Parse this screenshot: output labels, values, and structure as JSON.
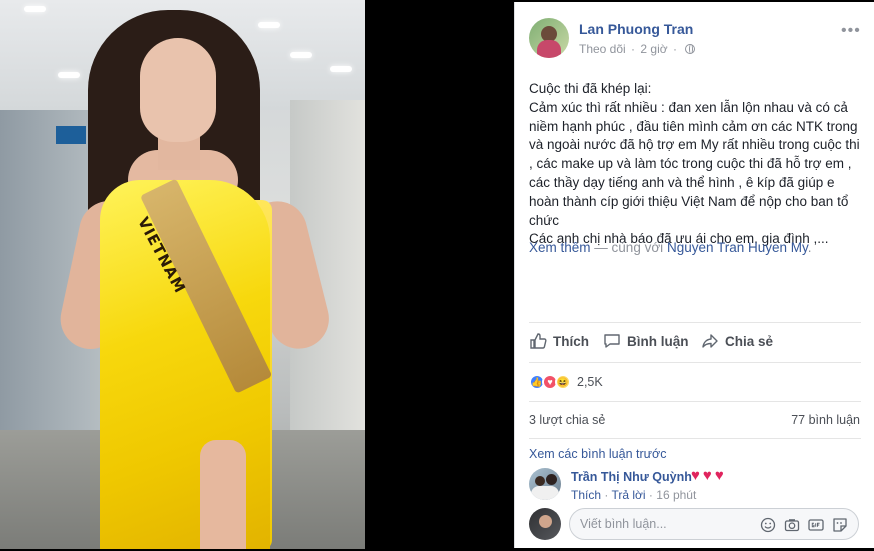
{
  "post": {
    "author": "Lan Phuong Tran",
    "follow_label": "Theo dõi",
    "time": "2 giờ",
    "body_lines": [
      "Cuộc thi đã khép lại:",
      "Cảm xúc thì rất nhiều : đan xen lẫn lộn nhau và có cả niềm hạnh phúc , đầu tiên mình cảm ơn các NTK trong và ngoài nước đã hộ trợ em My rất nhiều trong cuộc thi , các make up và làm tóc trong cuộc thi đã hỗ trợ em , các thầy dạy tiếng anh và thể hình , ê kíp đã giúp e hoàn thành cíp giới thiệu Việt Nam để nộp cho ban tổ chức",
      "Các anh chị nhà báo đã ưu ái cho em, gia đình ,..."
    ],
    "see_more": "Xem thêm",
    "with_text": "— cùng với",
    "tagged": "Nguyen Tran Huyen My",
    "tagged_suffix": "."
  },
  "photo": {
    "sash_text": "VIETNAM"
  },
  "actions": {
    "like": "Thích",
    "comment": "Bình luận",
    "share": "Chia sẻ"
  },
  "reactions": {
    "count": "2,5K"
  },
  "stats": {
    "shares": "3 lượt chia sẻ",
    "comments": "77 bình luận"
  },
  "comments": {
    "previous_label": "Xem các bình luận trước",
    "items": [
      {
        "name": "Trần Thị Như Quỳnh",
        "text": "♥♥♥",
        "like": "Thích",
        "reply": "Trả lời",
        "time": "16 phút"
      }
    ]
  },
  "composer": {
    "placeholder": "Viết bình luận..."
  },
  "colors": {
    "link": "#365899",
    "meta": "#90949c",
    "text": "#1d2129",
    "like_blue": "#4080ff",
    "love_red": "#f25268",
    "haha_yellow": "#fcd860"
  },
  "icons": [
    "more-icon",
    "globe-icon",
    "like-icon",
    "comment-icon",
    "share-icon",
    "emoji-icon",
    "camera-icon",
    "gif-icon",
    "sticker-icon"
  ]
}
